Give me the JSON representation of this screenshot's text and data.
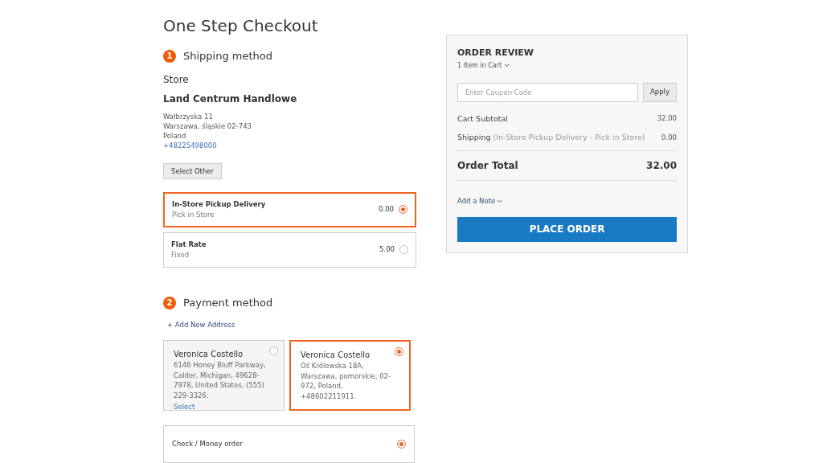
{
  "page_title": "One Step Checkout",
  "shipping": {
    "step": "1",
    "heading": "Shipping method",
    "store_label": "Store",
    "store_name": "Land Centrum Handlowe",
    "address_lines": [
      "Wałbrzyska 11",
      "Warszawa, śląskie 02-743",
      "Poland"
    ],
    "phone": "+48225498000",
    "select_other": "Select Other",
    "methods": [
      {
        "name": "In-Store Pickup Delivery",
        "carrier": "Pick in Store",
        "price": "0.00",
        "selected": true
      },
      {
        "name": "Flat Rate",
        "carrier": "Fixed",
        "price": "5.00",
        "selected": false
      }
    ]
  },
  "payment": {
    "step": "2",
    "heading": "Payment method",
    "add_address": "+ Add New Address",
    "addresses": [
      {
        "name": "Veronica Costello",
        "lines": "6146 Honey Bluff Parkway, Calder, Michigan, 49628-7978, United States, (555) 229-3326.",
        "action": "Select",
        "selected": false
      },
      {
        "name": "Veronica Costello",
        "lines": "Oś Królewska 18A, Warszawa, pomorskie, 02-972, Poland, +48602211911.",
        "selected": true
      }
    ],
    "methods": [
      {
        "name": "Check / Money order",
        "selected": true
      }
    ]
  },
  "order_review": {
    "title": "ORDER REVIEW",
    "items_in_cart": "1 Item in Cart",
    "coupon_placeholder": "Enter Coupon Code",
    "apply": "Apply",
    "subtotal_label": "Cart Subtotal",
    "subtotal": "32.00",
    "shipping_label": "Shipping",
    "shipping_detail": "(In-Store Pickup Delivery - Pick in Store)",
    "shipping": "0.00",
    "total_label": "Order Total",
    "total": "32.00",
    "add_note": "Add a Note",
    "place_order": "PLACE ORDER"
  }
}
